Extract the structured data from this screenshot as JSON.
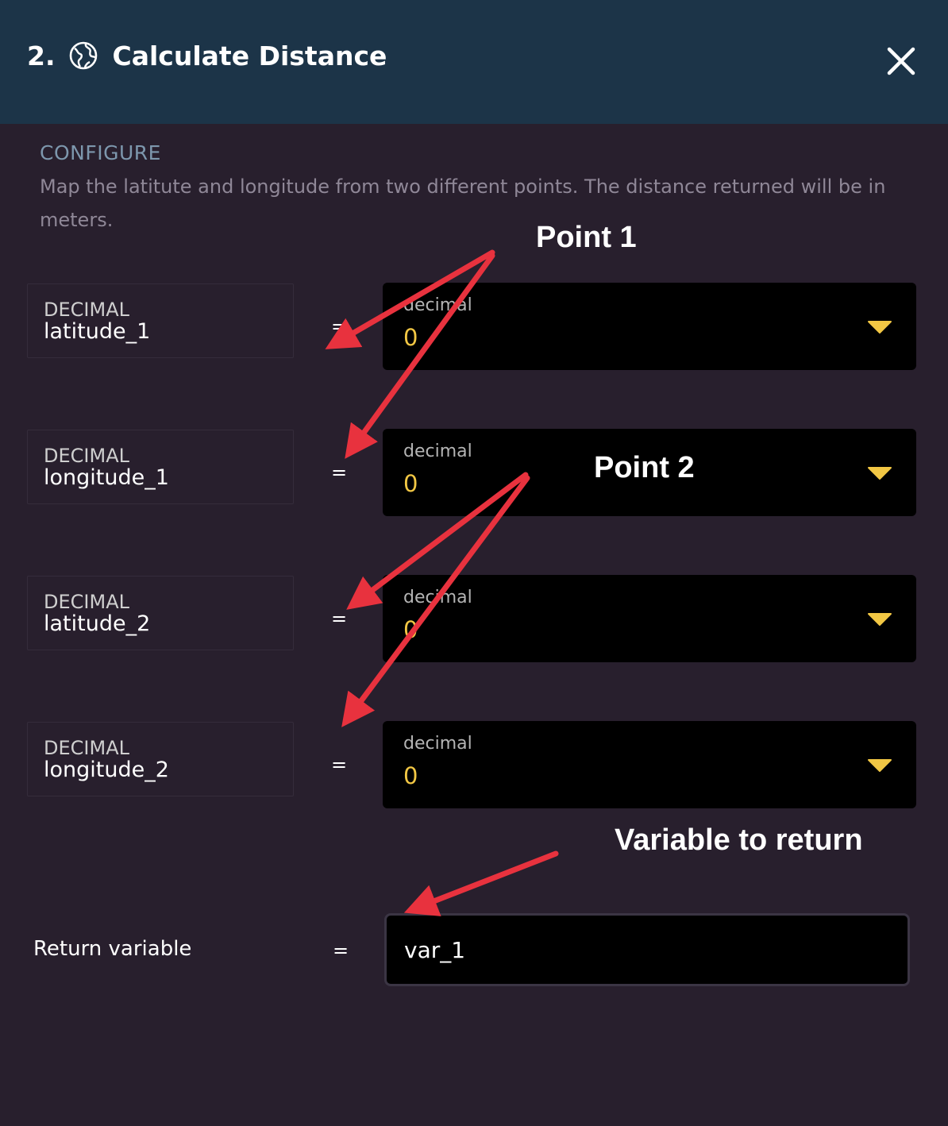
{
  "header": {
    "step_number": "2.",
    "title": "Calculate Distance"
  },
  "configure": {
    "section_title": "CONFIGURE",
    "description": "Map the latitute and longitude from two different points. The distance returned will be in meters."
  },
  "params": [
    {
      "type": "DECIMAL",
      "name": "latitude_1",
      "equals": "=",
      "select_type": "decimal",
      "select_value": "0"
    },
    {
      "type": "DECIMAL",
      "name": "longitude_1",
      "equals": "=",
      "select_type": "decimal",
      "select_value": "0"
    },
    {
      "type": "DECIMAL",
      "name": "latitude_2",
      "equals": "=",
      "select_type": "decimal",
      "select_value": "0"
    },
    {
      "type": "DECIMAL",
      "name": "longitude_2",
      "equals": "=",
      "select_type": "decimal",
      "select_value": "0"
    }
  ],
  "return": {
    "label": "Return variable",
    "equals": "=",
    "value": "var_1"
  },
  "annotations": {
    "point1": "Point 1",
    "point2": "Point 2",
    "variable_to_return": "Variable to return"
  },
  "colors": {
    "header_bg": "#1c3448",
    "page_bg": "#281f2d",
    "accent_value": "#f2c744",
    "annotation_arrow": "#e8323e"
  },
  "icons": {
    "title_icon": "globe-icon",
    "close": "close-icon",
    "dropdown": "caret-down-icon"
  }
}
